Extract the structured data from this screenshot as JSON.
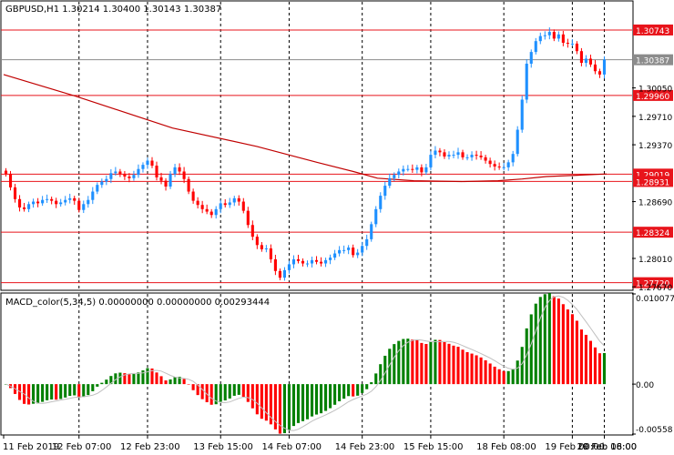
{
  "chart_data": [
    {
      "type": "candlestick",
      "title": "GBPUSD,H1  1.30214 1.30400 1.30143 1.30387",
      "ylim": [
        1.2764,
        1.3108
      ],
      "x_ticks": [
        "11 Feb 2019",
        "12 Feb 07:00",
        "12 Feb 23:00",
        "13 Feb 15:00",
        "14 Feb 07:00",
        "14 Feb 23:00",
        "15 Feb 15:00",
        "18 Feb 08:00",
        "19 Feb 00:00",
        "19 Feb 16:00",
        "20 Feb 08:00"
      ],
      "y_ticks": [
        1.30743,
        1.30387,
        1.3005,
        1.2996,
        1.2971,
        1.2937,
        1.29019,
        1.28931,
        1.2869,
        1.28324,
        1.2801,
        1.2772,
        1.2767
      ],
      "y_tick_labels": [
        "1.30743",
        "1.30387",
        "1.30050",
        "1.29960",
        "1.29710",
        "1.29370",
        "1.29019",
        "1.28931",
        "1.28690",
        "1.28324",
        "1.28010",
        "1.27720",
        "1.27670"
      ],
      "levels": [
        {
          "price": 1.30743,
          "label": "1.30743",
          "color": "#e8141b"
        },
        {
          "price": 1.30387,
          "label": "1.30387",
          "color": "#8c8c8c"
        },
        {
          "price": 1.2996,
          "label": "1.29960",
          "color": "#e8141b"
        },
        {
          "price": 1.29019,
          "label": "1.29019",
          "color": "#e8141b"
        },
        {
          "price": 1.28931,
          "label": "1.28931",
          "color": "#e8141b"
        },
        {
          "price": 1.28324,
          "label": "1.28324",
          "color": "#e8141b"
        },
        {
          "price": 1.2772,
          "label": "1.27720",
          "color": "#e8141b"
        }
      ],
      "close": [
        1.2902,
        1.2886,
        1.2872,
        1.2862,
        1.286,
        1.2866,
        1.2869,
        1.2867,
        1.2871,
        1.2872,
        1.287,
        1.2866,
        1.2868,
        1.2871,
        1.2873,
        1.287,
        1.2859,
        1.2866,
        1.2871,
        1.2881,
        1.2889,
        1.2893,
        1.2896,
        1.2903,
        1.2905,
        1.2902,
        1.2899,
        1.2897,
        1.2901,
        1.2908,
        1.2913,
        1.2918,
        1.2912,
        1.2898,
        1.2894,
        1.2887,
        1.2902,
        1.291,
        1.2905,
        1.2896,
        1.2881,
        1.287,
        1.2865,
        1.286,
        1.2857,
        1.2853,
        1.286,
        1.2867,
        1.2865,
        1.2868,
        1.2873,
        1.2869,
        1.2858,
        1.2841,
        1.2827,
        1.2817,
        1.2812,
        1.2813,
        1.28,
        1.2786,
        1.2778,
        1.2787,
        1.2794,
        1.28,
        1.2798,
        1.2795,
        1.2795,
        1.2799,
        1.2797,
        1.2795,
        1.2799,
        1.2802,
        1.2807,
        1.2811,
        1.2811,
        1.2814,
        1.2805,
        1.2808,
        1.2816,
        1.2824,
        1.2842,
        1.286,
        1.2876,
        1.2888,
        1.2897,
        1.2901,
        1.2905,
        1.2908,
        1.2908,
        1.2907,
        1.291,
        1.2904,
        1.291,
        1.2925,
        1.293,
        1.2928,
        1.2923,
        1.2925,
        1.2925,
        1.2928,
        1.2922,
        1.2922,
        1.2925,
        1.2924,
        1.2922,
        1.2918,
        1.2914,
        1.2911,
        1.291,
        1.291,
        1.2916,
        1.2926,
        1.2955,
        1.2991,
        1.3034,
        1.3048,
        1.3061,
        1.3067,
        1.3068,
        1.3072,
        1.3064,
        1.3069,
        1.3059,
        1.3058,
        1.3058,
        1.3049,
        1.3035,
        1.304,
        1.3033,
        1.3025,
        1.3021,
        1.3039
      ],
      "ma_points": [
        [
          0,
          1.3021
        ],
        [
          0.12,
          1.2995
        ],
        [
          0.28,
          1.2957
        ],
        [
          0.42,
          1.2935
        ],
        [
          0.52,
          1.2916
        ],
        [
          0.58,
          1.2905
        ],
        [
          0.62,
          1.2897
        ],
        [
          0.68,
          1.2894
        ],
        [
          0.76,
          1.2893
        ],
        [
          0.82,
          1.2894
        ],
        [
          0.86,
          1.2896
        ],
        [
          0.9,
          1.2899
        ],
        [
          1.0,
          1.2902
        ]
      ]
    },
    {
      "type": "bar",
      "title": "MACD_color(5,34,5) 0.00000000 0.00000000 0.00293444",
      "ylim": [
        -0.00558,
        0.0100775
      ],
      "y_ticks": [
        0.0100775,
        0.0,
        -0.00558
      ],
      "y_tick_labels": [
        "0.0100775",
        "0.00",
        "-0.00558"
      ],
      "colors": {
        "up": "#008000",
        "down": "#ff0000"
      },
      "signal_color": "#c0c0c0"
    }
  ]
}
